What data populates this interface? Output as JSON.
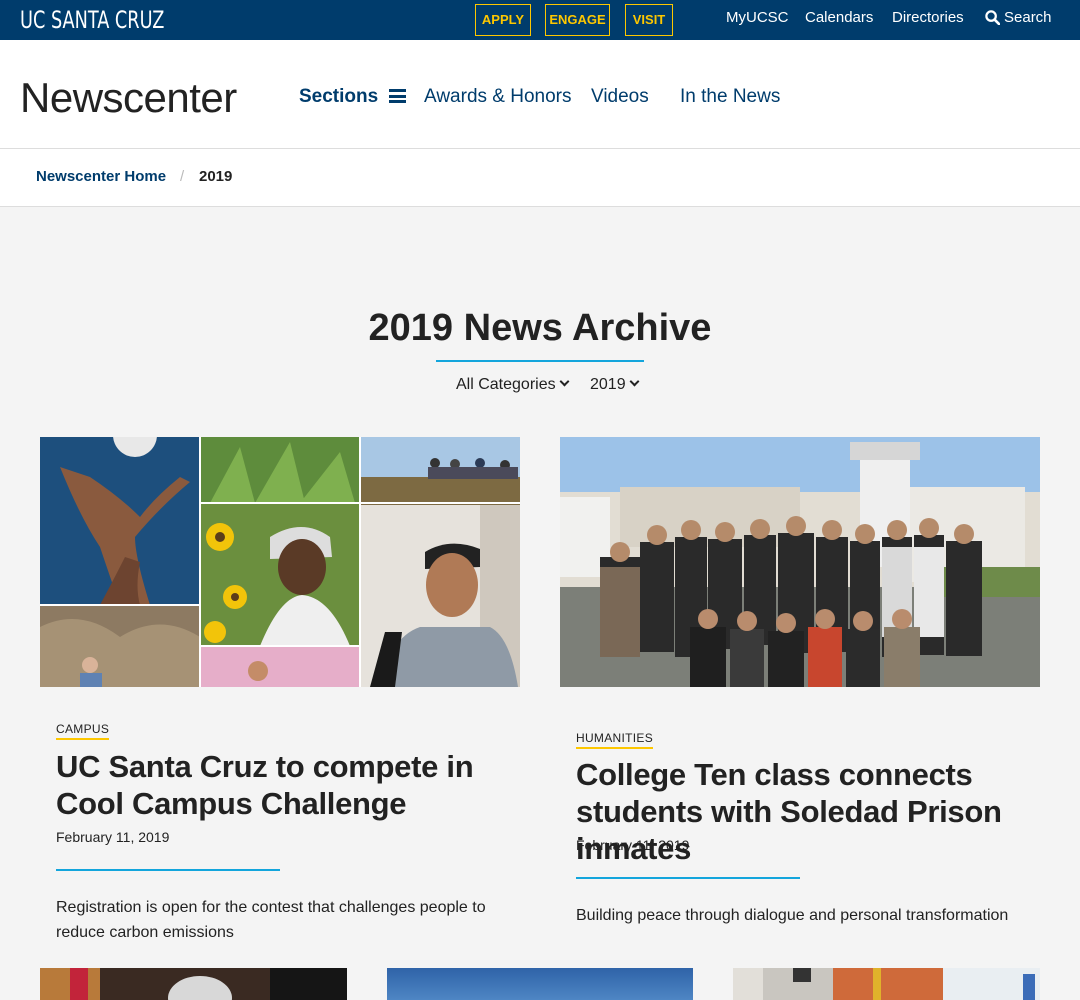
{
  "topbar": {
    "logo": "UC SANTA CRUZ",
    "cta": [
      "APPLY",
      "ENGAGE",
      "VISIT"
    ],
    "links": [
      "MyUCSC",
      "Calendars",
      "Directories"
    ],
    "search_label": "Search"
  },
  "header": {
    "site_title": "Newscenter",
    "nav": {
      "sections": "Sections",
      "awards": "Awards & Honors",
      "videos": "Videos",
      "in_the_news": "In the News"
    }
  },
  "breadcrumb": {
    "home": "Newscenter Home",
    "separator": "/",
    "current": "2019"
  },
  "archive": {
    "title": "2019 News Archive",
    "filter_category": "All Categories",
    "filter_year": "2019"
  },
  "articles": [
    {
      "category": "CAMPUS",
      "title": "UC Santa Cruz to compete in Cool Campus Challenge",
      "date": "February 11, 2019",
      "summary": "Registration is open for the contest that challenges people to reduce carbon emissions"
    },
    {
      "category": "HUMANITIES",
      "title": "College Ten class connects students with Soledad Prison inmates",
      "date": "February 11, 2019",
      "summary": "Building peace through dialogue and personal transformation"
    }
  ],
  "colors": {
    "brand_blue": "#003c6c",
    "gold": "#fdc700",
    "accent_blue": "#13a5dc"
  },
  "icons": {
    "search": "search-icon",
    "menu": "hamburger-icon",
    "dropdown": "chevron-down-icon"
  }
}
